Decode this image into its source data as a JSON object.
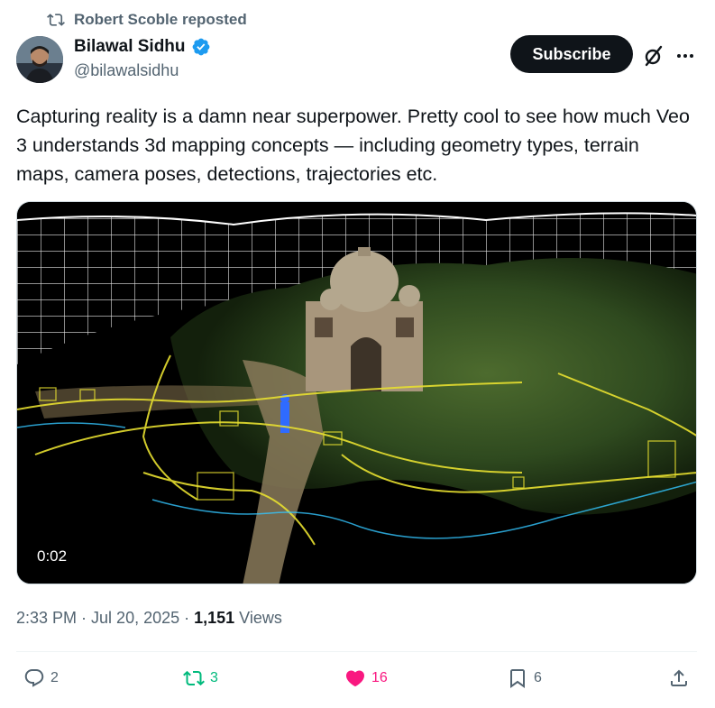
{
  "repost_banner": {
    "text": "Robert Scoble reposted",
    "icon": "repost-icon"
  },
  "author": {
    "display_name": "Bilawal Sidhu",
    "handle": "@bilawalsidhu",
    "verified": true,
    "verified_color": "#1d9bf0"
  },
  "header_actions": {
    "subscribe_label": "Subscribe",
    "grok_icon": "grok-icon",
    "more_icon": "more-icon"
  },
  "tweet": {
    "text": "Capturing reality is a damn near superpower. Pretty cool to see how much Veo 3 understands 3d mapping concepts — including geometry types, terrain maps, camera poses, detections, trajectories etc."
  },
  "media": {
    "type": "video",
    "duration": "0:02"
  },
  "meta": {
    "time": "2:33 PM",
    "date": "Jul 20, 2025",
    "views_count": "1,151",
    "views_label": "Views"
  },
  "actions": {
    "replies": "2",
    "reposts": "3",
    "likes": "16",
    "bookmarks": "6"
  },
  "colors": {
    "repost_active": "#00ba7c",
    "like_active": "#f91880",
    "muted_text": "#536471",
    "primary_text": "#0f1419"
  }
}
